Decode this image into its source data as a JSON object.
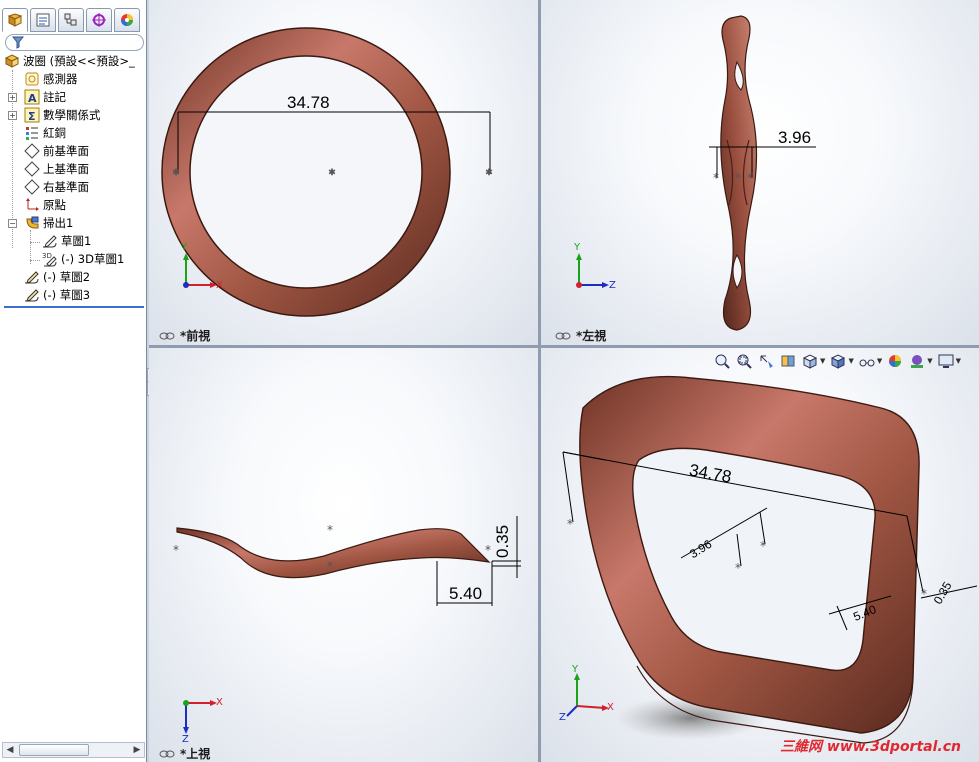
{
  "feature_tree": {
    "root_label": "波圈 (預設<<預設>_",
    "items": [
      {
        "label": "感測器",
        "icon": "sensor-icon"
      },
      {
        "label": "註記",
        "icon": "annotations-icon"
      },
      {
        "label": "數學關係式",
        "icon": "equations-icon"
      },
      {
        "label": "紅銅",
        "icon": "material-icon"
      },
      {
        "label": "前基準面",
        "icon": "plane-icon"
      },
      {
        "label": "上基準面",
        "icon": "plane-icon"
      },
      {
        "label": "右基準面",
        "icon": "plane-icon"
      },
      {
        "label": "原點",
        "icon": "origin-icon"
      },
      {
        "label": "掃出1",
        "icon": "sweep-icon"
      },
      {
        "label": "草圖1",
        "icon": "sketch-icon"
      },
      {
        "label": "(-) 3D草圖1",
        "icon": "3d-sketch-icon"
      },
      {
        "label": "(-) 草圖2",
        "icon": "sketch-icon"
      },
      {
        "label": "(-) 草圖3",
        "icon": "sketch-icon"
      }
    ]
  },
  "views": {
    "front": {
      "label": "*前視",
      "dim_diameter": "34.78"
    },
    "left": {
      "label": "*左視",
      "dim_thickness": "3.96"
    },
    "top": {
      "label": "*上視",
      "dim_height": "0.35",
      "dim_width": "5.40"
    },
    "iso": {
      "dim_diameter": "34.78",
      "dim_thickness": "3.96",
      "dim_width": "5.40",
      "dim_height": "0.35"
    }
  },
  "triad": {
    "x": "X",
    "y": "Y",
    "z": "Z"
  },
  "watermark": "三維网 www.3dportal.cn",
  "colors": {
    "copper": "#b0604a",
    "accent_selection": "#3b6fcf"
  }
}
